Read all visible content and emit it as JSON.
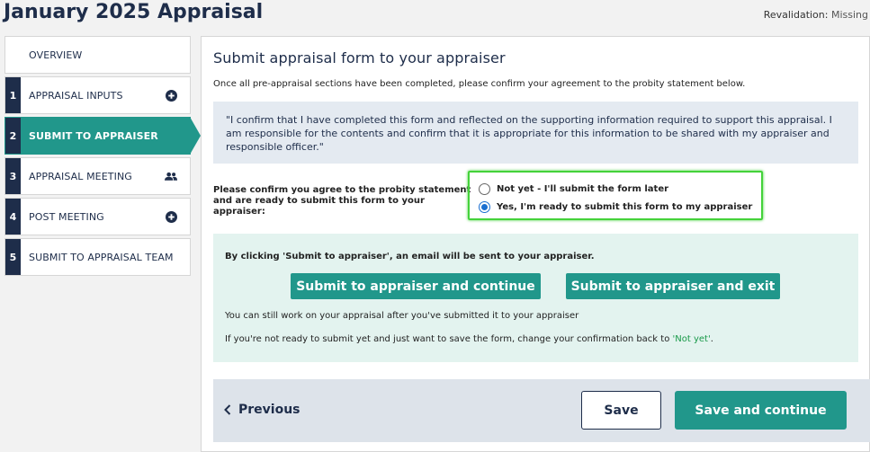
{
  "header": {
    "title": "January 2025 Appraisal",
    "revalidation_label": "Revalidation:",
    "revalidation_value": "Missing"
  },
  "sidebar": {
    "items": [
      {
        "number": "",
        "label": "OVERVIEW",
        "icon": ""
      },
      {
        "number": "1",
        "label": "APPRAISAL INPUTS",
        "icon": "plus-circle-icon"
      },
      {
        "number": "2",
        "label": "SUBMIT TO APPRAISER",
        "icon": "",
        "active": true
      },
      {
        "number": "3",
        "label": "APPRAISAL MEETING",
        "icon": "people-icon"
      },
      {
        "number": "4",
        "label": "POST MEETING",
        "icon": "plus-circle-icon"
      },
      {
        "number": "5",
        "label": "SUBMIT TO APPRAISAL TEAM",
        "icon": ""
      }
    ]
  },
  "main": {
    "heading": "Submit appraisal form to your appraiser",
    "intro": "Once all pre-appraisal sections have been completed, please confirm your agreement to the probity statement below.",
    "probity_statement": "\"I confirm that I have completed this form and reflected on the supporting information required to support this appraisal. I am responsible for the contents and confirm that it is appropriate for this information to be shared with my appraiser and responsible officer.\"",
    "confirm_label_line1": "Please confirm you agree to the probity statement",
    "confirm_label_line2": "and are ready to submit this form to your appraiser:",
    "radio_options": [
      {
        "label": "Not yet - I'll submit the form later",
        "checked": false
      },
      {
        "label": "Yes, I'm ready to submit this form to my appraiser",
        "checked": true
      }
    ],
    "email_note": "By clicking 'Submit to appraiser', an email will be sent to your appraiser.",
    "submit_continue_label": "Submit to appraiser and continue",
    "submit_exit_label": "Submit to appraiser and exit",
    "note1": "You can still work on your appraisal after you've submitted it to your appraiser",
    "note2_prefix": "If you're not ready to submit yet and just want to save the form, change your confirmation back to ",
    "note2_link": "'Not yet'",
    "note2_suffix": "."
  },
  "footer": {
    "previous_label": "Previous",
    "save_label": "Save",
    "save_continue_label": "Save and continue"
  },
  "colors": {
    "navy": "#1e2d4a",
    "teal": "#21978b",
    "highlight_green": "#44d23a",
    "radio_blue": "#1a6fd0",
    "quote_bg": "#e4eaf1",
    "info_bg": "#e3f3ef",
    "footer_bg": "#dde3ea"
  }
}
